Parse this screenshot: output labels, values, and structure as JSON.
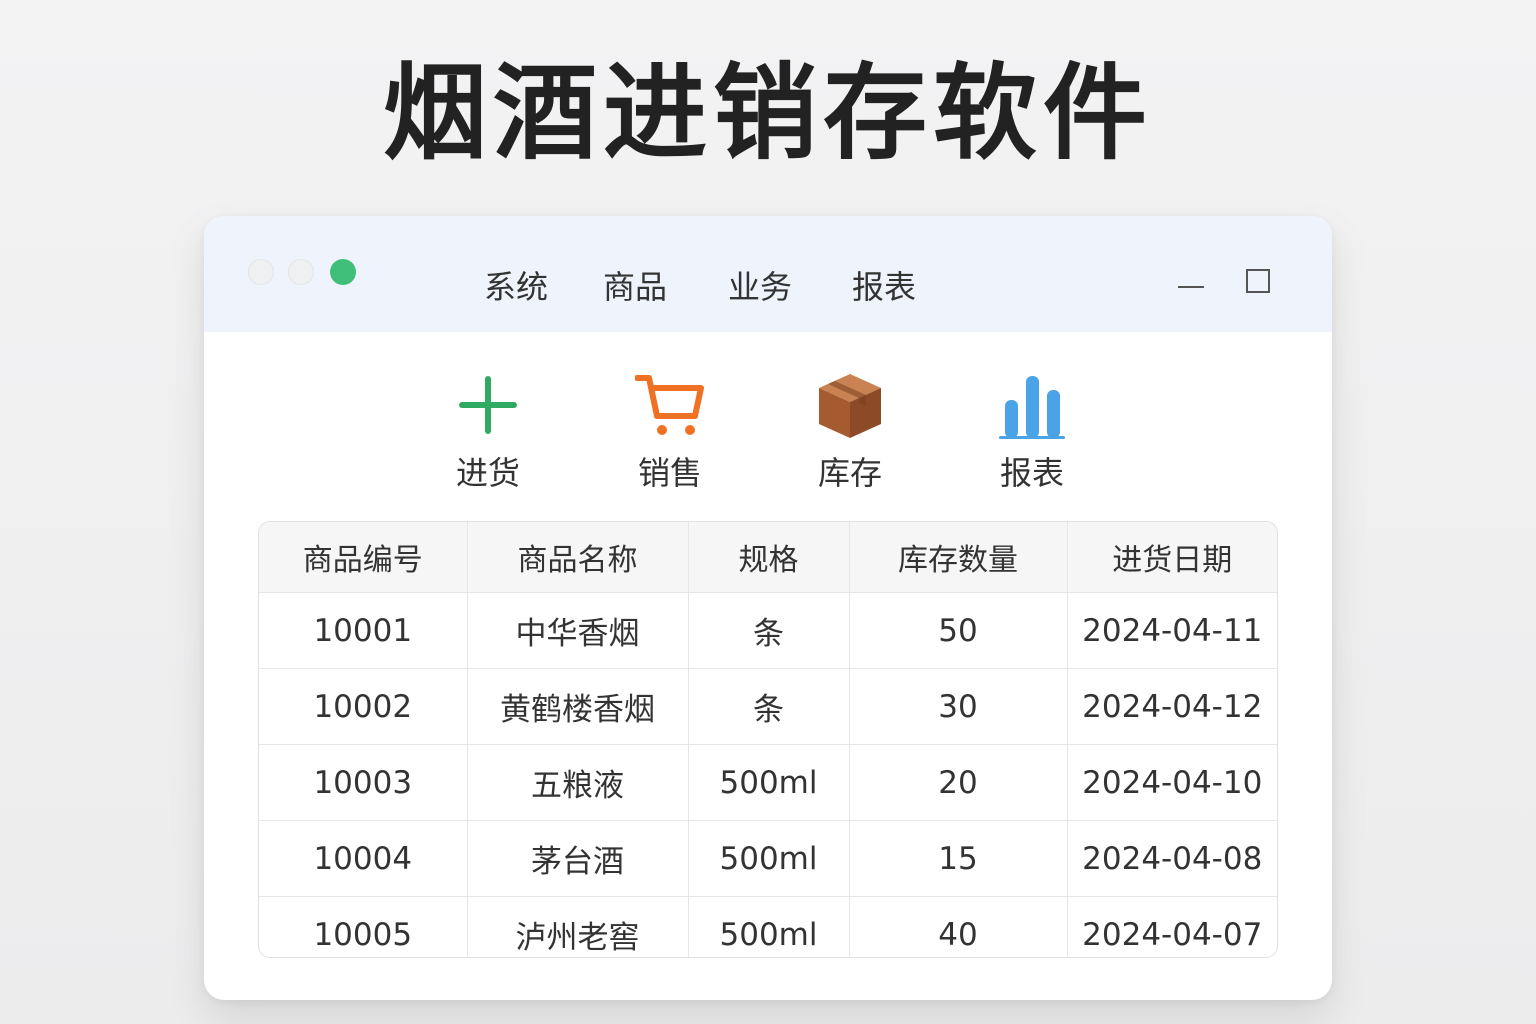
{
  "page_title": "烟酒进销存软件",
  "menu": [
    "系统",
    "商品",
    "业务",
    "报表"
  ],
  "toolbar": [
    {
      "label": "进货",
      "icon": "plus-icon",
      "color": "#2eaa63"
    },
    {
      "label": "销售",
      "icon": "cart-icon",
      "color": "#f07024"
    },
    {
      "label": "库存",
      "icon": "box-icon",
      "color": "#b86a3c"
    },
    {
      "label": "报表",
      "icon": "bar-chart-icon",
      "color": "#4aa3e6"
    }
  ],
  "table": {
    "headers": [
      "商品编号",
      "商品名称",
      "规格",
      "库存数量",
      "进货日期"
    ],
    "rows": [
      [
        "10001",
        "中华香烟",
        "条",
        "50",
        "2024-04-11"
      ],
      [
        "10002",
        "黄鹤楼香烟",
        "条",
        "30",
        "2024-04-12"
      ],
      [
        "10003",
        "五粮液",
        "500ml",
        "20",
        "2024-04-10"
      ],
      [
        "10004",
        "茅台酒",
        "500ml",
        "15",
        "2024-04-08"
      ],
      [
        "10005",
        "泸州老窖",
        "500ml",
        "40",
        "2024-04-07"
      ]
    ]
  },
  "colors": {
    "titlebar_bg": "#eef3fc",
    "close_dot": "#eef0f2",
    "maximize_dot": "#3fbf79"
  }
}
